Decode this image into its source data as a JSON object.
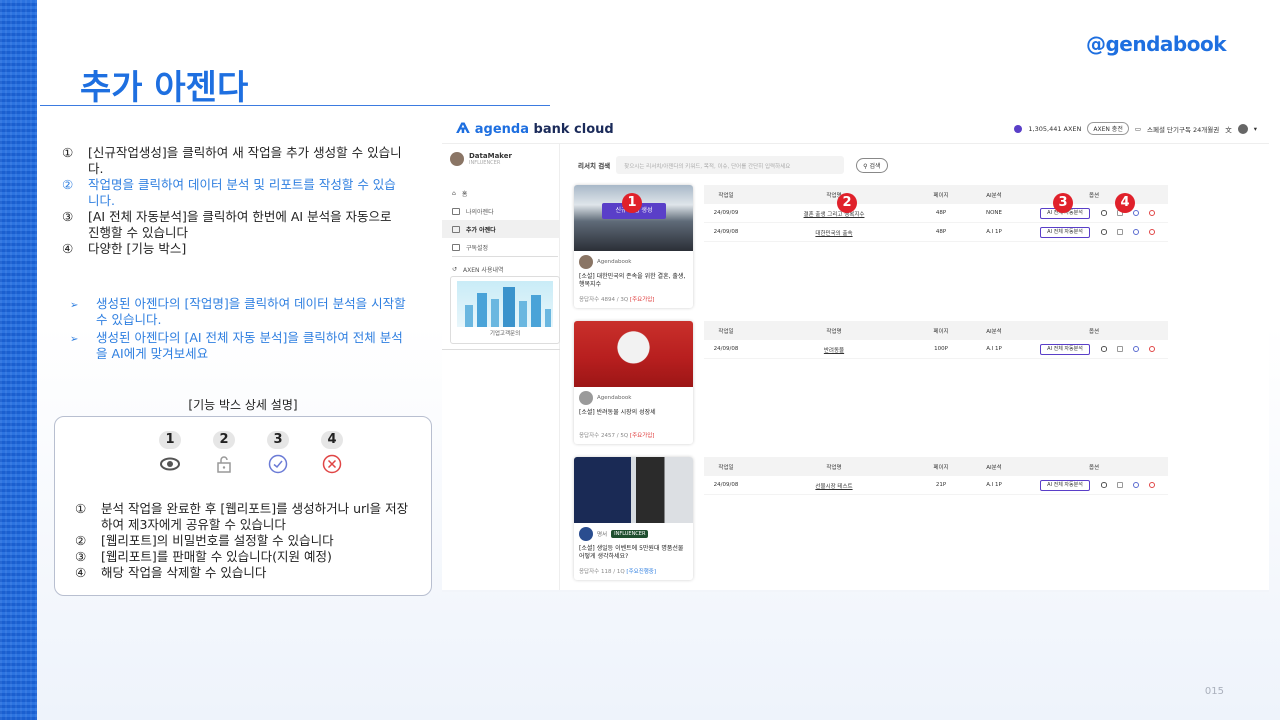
{
  "brand": "@gendabook",
  "title": "추가 아젠다",
  "page_number": "015",
  "steps": [
    {
      "num": "①",
      "text": "[신규작업생성]을 클릭하여 새 작업을 추가 생성할 수 있습니다."
    },
    {
      "num": "②",
      "text": "작업명을 클릭하여 데이터 분석 및 리포트를 작성할 수 있습니다."
    },
    {
      "num": "③",
      "text": "[AI 전체 자동분석]을 클릭하여 한번에 AI 분석을 자동으로 진행할 수 있습니다"
    },
    {
      "num": "④",
      "text": "다양한 [기능 박스]"
    }
  ],
  "notes": [
    {
      "arrow": "➢",
      "text": "생성된 아젠다의 [작업명]을 클릭하여 데이터 분석을 시작할 수 있습니다."
    },
    {
      "arrow": "➢",
      "text": "생성된 아젠다의 [AI 전체 자동 분석]을 클릭하여 전체 분석을 AI에게 맞겨보세요"
    }
  ],
  "feature_box": {
    "caption": "[기능 박스 상세 설명]",
    "icons": [
      {
        "num": "1",
        "icon": "eye-icon",
        "color": "#555555"
      },
      {
        "num": "2",
        "icon": "lock-icon",
        "color": "#999999"
      },
      {
        "num": "3",
        "icon": "check-circle-icon",
        "color": "#6b7bd6"
      },
      {
        "num": "4",
        "icon": "x-circle-icon",
        "color": "#e04545"
      }
    ],
    "items": [
      {
        "num": "①",
        "text": "분석 작업을 완료한 후 [웹리포트]를 생성하거나 url을 저장하여 제3자에게 공유할 수 있습니다"
      },
      {
        "num": "②",
        "text": "[웹리포트]의 비밀번호를 설정할 수 있습니다"
      },
      {
        "num": "③",
        "text": "[웹리포트]를 판매할 수 있습니다(지원 예정)"
      },
      {
        "num": "④",
        "text": "해당 작업을 삭제할 수 있습니다"
      }
    ]
  },
  "app": {
    "logo_agenda": "agenda",
    "logo_rest": " bank cloud",
    "header": {
      "axen": "1,305,441 AXEN",
      "axen_btn": "AXEN 충전",
      "subscription": "스페셜 단기구독 24개월권"
    },
    "profile": {
      "name": "DataMaker",
      "sub": "INFLUENCER"
    },
    "menu": [
      "홈",
      "나의아젠다",
      "추가 아젠다",
      "구독설정",
      "AXEN 사용내역"
    ],
    "side_card_caption": "기업고객문의",
    "search": {
      "label": "리서치 검색",
      "placeholder": "찾으시는 리서치/아젠다의 키워드, 목적, 이슈, 단어를 간단히 입력하세요",
      "button": "검색"
    },
    "columns": [
      "작업일",
      "작업명",
      "페이지",
      "AI분석",
      "옵션"
    ],
    "ai_button": "AI 전체 자동분석",
    "new_task_button": "신규 작업 생성",
    "cards": [
      {
        "author": "Agendabook",
        "title": "[소설] 대한민국의 존속을 위한 결혼, 출생, 행복지수",
        "stats": "응답자수 4894 / 3Q",
        "tag": "[주요가입]",
        "tag_color": "red",
        "rows": [
          {
            "date": "24/09/09",
            "name": "결혼 출생 그리고 행복지수",
            "pages": "48P",
            "ai": "NONE"
          },
          {
            "date": "24/09/08",
            "name": "대한민국의 출속",
            "pages": "48P",
            "ai": "A.I 1P"
          }
        ]
      },
      {
        "author": "Agendabook",
        "title": "[소셜] 반려동물 시장의 성장세",
        "stats": "응답자수 2457 / 5Q",
        "tag": "[주요가입]",
        "tag_color": "red",
        "rows": [
          {
            "date": "24/09/08",
            "name": "반려동물",
            "pages": "100P",
            "ai": "A.I 1P"
          }
        ]
      },
      {
        "author": "명서",
        "badge": "INFLUENCER",
        "title": "[소셜] 생일등 이벤트에 5만원대 명품선물 어떻게 생각하세요?",
        "stats": "응답자수 118 / 1Q",
        "tag": "[주요진행중]",
        "tag_color": "blue",
        "rows": [
          {
            "date": "24/09/08",
            "name": "선물시장 테스트",
            "pages": "21P",
            "ai": "A.I 1P"
          }
        ]
      }
    ]
  },
  "markers": [
    "1",
    "2",
    "3",
    "4"
  ]
}
